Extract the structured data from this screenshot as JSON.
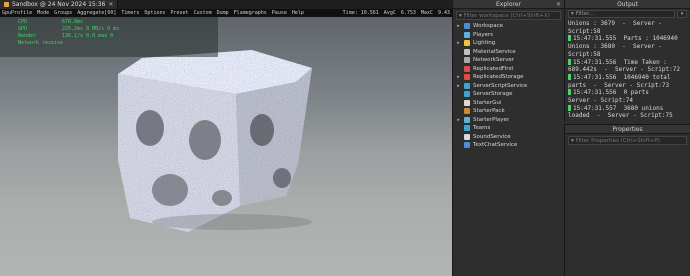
{
  "document_tab": {
    "title": "Sandbox @ 24 Nov 2024 15:36",
    "close": "✕"
  },
  "profiler": {
    "left_items": [
      "GpuProfile",
      "Mode",
      "Groups",
      "Aggregate[60]",
      "Timers",
      "Options",
      "Preset",
      "Custom",
      "Dump",
      "Flamegraphs",
      "Pause",
      "Help"
    ],
    "time": "Time: 10.561",
    "avg": "AvgC",
    "fps": "6.753",
    "max": "MaxC",
    "tail": "9.43"
  },
  "stats": [
    {
      "key": "CPU",
      "value": "  678.0ms"
    },
    {
      "key": "GPU",
      "value": "  225.2ms 8 MB/s 0 ms"
    },
    {
      "key": "Render",
      "value": "  136.1/s 0.0 max 0"
    },
    {
      "key": "Network receive",
      "value": ""
    }
  ],
  "explorer": {
    "title": "Explorer",
    "close": "✕",
    "filter_placeholder": "Filter workspace (Ctrl+Shift+X)",
    "items": [
      {
        "label": "Workspace",
        "expandable": true,
        "color": "#4a8fd9"
      },
      {
        "label": "Players",
        "expandable": false,
        "color": "#5fb3e0"
      },
      {
        "label": "Lighting",
        "expandable": true,
        "color": "#f0c33c"
      },
      {
        "label": "MaterialService",
        "expandable": false,
        "color": "#c2c2c2"
      },
      {
        "label": "NetworkServer",
        "expandable": false,
        "color": "#a9a9a9"
      },
      {
        "label": "ReplicatedFirst",
        "expandable": false,
        "color": "#e04a4a"
      },
      {
        "label": "ReplicatedStorage",
        "expandable": true,
        "color": "#e04a4a"
      },
      {
        "label": "ServerScriptService",
        "expandable": true,
        "color": "#3fa4d0"
      },
      {
        "label": "ServerStorage",
        "expandable": false,
        "color": "#3fa4d0"
      },
      {
        "label": "StarterGui",
        "expandable": false,
        "color": "#d9d9d9"
      },
      {
        "label": "StarterPack",
        "expandable": false,
        "color": "#c98a3a"
      },
      {
        "label": "StarterPlayer",
        "expandable": true,
        "color": "#5fb3e0"
      },
      {
        "label": "Teams",
        "expandable": false,
        "color": "#3fa4d0"
      },
      {
        "label": "SoundService",
        "expandable": false,
        "color": "#d9d9d9"
      },
      {
        "label": "TextChatService",
        "expandable": false,
        "color": "#4a8fd9"
      }
    ]
  },
  "output": {
    "title": "Output",
    "filter_placeholder": "Filter...",
    "lines": [
      {
        "mark": false,
        "text": "Unions : 3679  -  Server -"
      },
      {
        "mark": false,
        "text": "Script:58"
      },
      {
        "mark": true,
        "text": "15:47:31.555  Parts : 1046940"
      },
      {
        "mark": false,
        "text": "Unions : 3680  -  Server -"
      },
      {
        "mark": false,
        "text": "Script:58"
      },
      {
        "mark": true,
        "text": "15:47:31.556  Time Taken :"
      },
      {
        "mark": false,
        "text": "689.442s  -  Server - Script:72"
      },
      {
        "mark": true,
        "text": "15:47:31.556  1046940 total"
      },
      {
        "mark": false,
        "text": "parts  -  Server - Script:73"
      },
      {
        "mark": true,
        "text": "15:47:31.556  0 parts"
      },
      {
        "mark": false,
        "text": "Server - Script:74"
      },
      {
        "mark": true,
        "text": "15:47:31.557  3680 unions"
      },
      {
        "mark": false,
        "text": "loaded  -  Server - Script:75"
      }
    ]
  },
  "properties": {
    "title": "Properties",
    "filter_placeholder": "Filter Properties (Ctrl+Shift+P)"
  }
}
